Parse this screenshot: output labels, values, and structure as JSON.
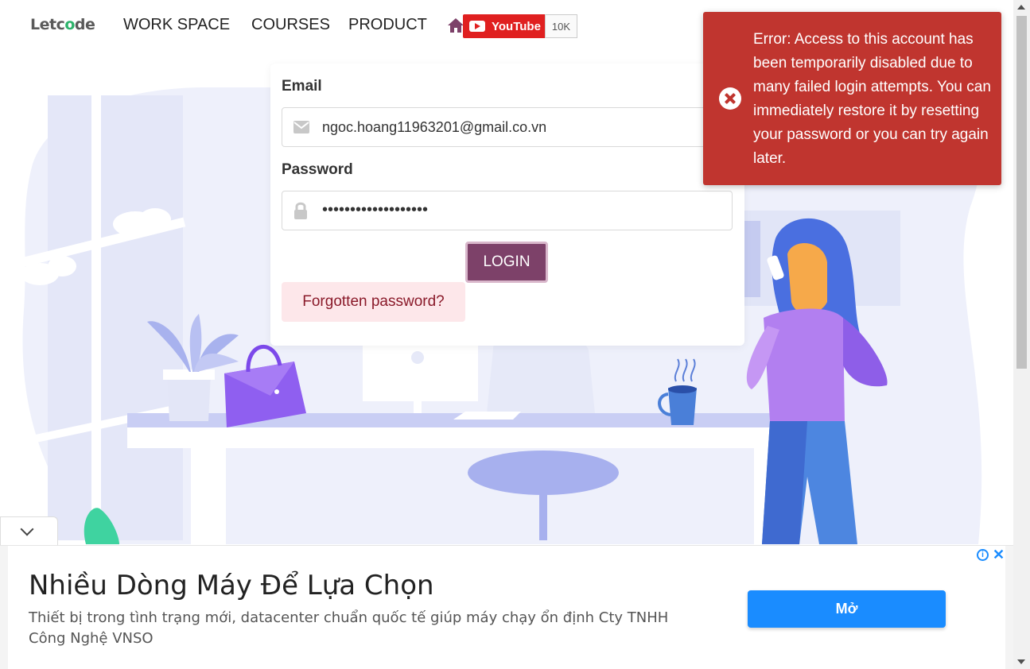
{
  "navbar": {
    "logo": "Letcode",
    "links": [
      "WORK SPACE",
      "COURSES",
      "PRODUCT"
    ],
    "youtube_label": "YouTube",
    "youtube_count": "10K"
  },
  "login": {
    "email_label": "Email",
    "email_value": "ngoc.hoang11963201@gmail.co.vn",
    "password_label": "Password",
    "password_value": "•••••••••••••••••••",
    "login_button": "LOGIN",
    "forgot_button": "Forgotten password?"
  },
  "error_toast": {
    "message": "Error: Access to this account has been temporarily disabled due to many failed login attempts. You can immediately restore it by resetting your password or you can try again later."
  },
  "ad": {
    "title": "Nhiều Dòng Máy Để Lựa Chọn",
    "description": "Thiết bị trong tình trạng mới, datacenter chuẩn quốc tế giúp máy chạy ổn định Cty TNHH Công Nghệ VNSO",
    "open_button": "Mở",
    "info_icon": "info-icon",
    "close_icon": "close-icon"
  },
  "colors": {
    "login_button": "#7d4169",
    "error_bg": "#c0352f",
    "ad_button": "#1a8cff",
    "youtube_red": "#e02020"
  }
}
